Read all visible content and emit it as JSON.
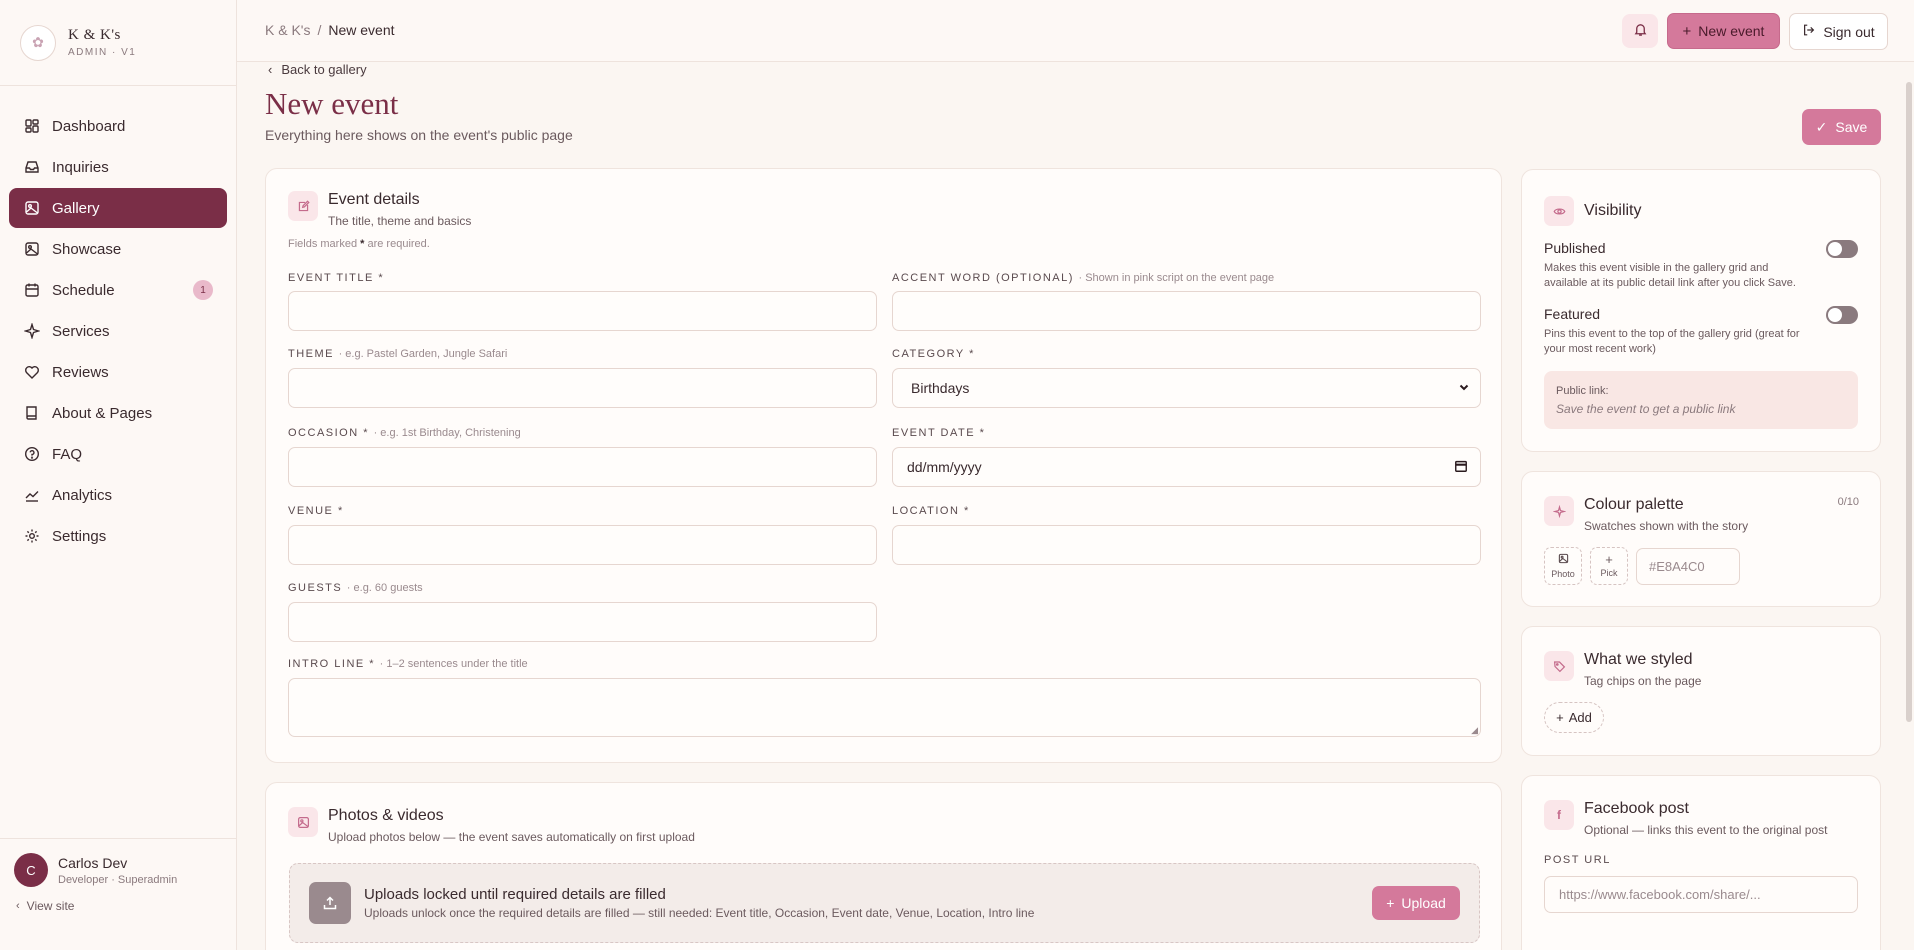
{
  "brand": {
    "name": "K & K's",
    "sub": "ADMIN · V1"
  },
  "sidebar": {
    "items": [
      {
        "label": "Dashboard",
        "icon": "dashboard-icon"
      },
      {
        "label": "Inquiries",
        "icon": "inbox-icon"
      },
      {
        "label": "Gallery",
        "icon": "gallery-icon",
        "active": true
      },
      {
        "label": "Showcase",
        "icon": "showcase-icon"
      },
      {
        "label": "Schedule",
        "icon": "calendar-icon",
        "badge": "1"
      },
      {
        "label": "Services",
        "icon": "sparkle-icon"
      },
      {
        "label": "Reviews",
        "icon": "heart-icon"
      },
      {
        "label": "About & Pages",
        "icon": "book-icon"
      },
      {
        "label": "FAQ",
        "icon": "help-icon"
      },
      {
        "label": "Analytics",
        "icon": "chart-icon"
      },
      {
        "label": "Settings",
        "icon": "gear-icon"
      }
    ]
  },
  "user": {
    "initial": "C",
    "name": "Carlos Dev",
    "role": "Developer · Superadmin",
    "view_site": "View site"
  },
  "topbar": {
    "breadcrumb_root": "K & K's",
    "breadcrumb_sep": "/",
    "breadcrumb_current": "New event",
    "new_event": "New event",
    "sign_out": "Sign out"
  },
  "page": {
    "back": "Back to gallery",
    "title": "New event",
    "subtitle": "Everything here shows on the event's public page",
    "save": "Save"
  },
  "event_details": {
    "title": "Event details",
    "subtitle": "The title, theme and basics",
    "required_note_a": "Fields marked ",
    "required_note_star": "*",
    "required_note_b": " are required.",
    "fields": {
      "event_title": {
        "label": "EVENT TITLE *",
        "hint": ""
      },
      "accent_word": {
        "label": "ACCENT WORD (OPTIONAL)",
        "hint": "· Shown in pink script on the event page"
      },
      "theme": {
        "label": "THEME",
        "hint": "· e.g. Pastel Garden, Jungle Safari"
      },
      "category": {
        "label": "CATEGORY *",
        "value": "Birthdays"
      },
      "occasion": {
        "label": "OCCASION *",
        "hint": "· e.g. 1st Birthday, Christening"
      },
      "event_date": {
        "label": "EVENT DATE *",
        "value": "dd/mm/yyyy"
      },
      "venue": {
        "label": "VENUE *"
      },
      "location": {
        "label": "LOCATION *"
      },
      "guests": {
        "label": "GUESTS",
        "hint": "· e.g. 60 guests"
      },
      "intro_line": {
        "label": "INTRO LINE *",
        "hint": "· 1–2 sentences under the title"
      }
    }
  },
  "photos": {
    "title": "Photos & videos",
    "subtitle": "Upload photos below — the event saves automatically on first upload",
    "locked_title": "Uploads locked until required details are filled",
    "locked_sub": "Uploads unlock once the required details are filled — still needed: Event title, Occasion, Event date, Venue, Location, Intro line",
    "upload": "Upload"
  },
  "visibility": {
    "title": "Visibility",
    "published_label": "Published",
    "published_desc": "Makes this event visible in the gallery grid and available at its public detail link after you click Save.",
    "published_on": false,
    "featured_label": "Featured",
    "featured_desc": "Pins this event to the top of the gallery grid (great for your most recent work)",
    "featured_on": false,
    "public_link_label": "Public link:",
    "public_link_value": "Save the event to get a public link"
  },
  "palette": {
    "title": "Colour palette",
    "subtitle": "Swatches shown with the story",
    "count": "0/10",
    "photo": "Photo",
    "pick": "Pick",
    "hex_placeholder": "#E8A4C0"
  },
  "styled": {
    "title": "What we styled",
    "subtitle": "Tag chips on the page",
    "add": "Add"
  },
  "facebook": {
    "title": "Facebook post",
    "subtitle": "Optional — links this event to the original post",
    "url_label": "POST URL",
    "url_placeholder": "https://www.facebook.com/share/..."
  },
  "colors": {
    "accent": "#7a2e47",
    "pink": "#d4799b",
    "background": "#fbf6f2"
  }
}
